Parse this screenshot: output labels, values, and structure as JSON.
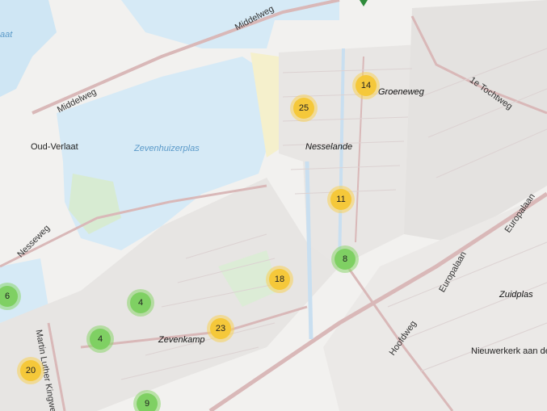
{
  "map": {
    "place_labels": {
      "groeneweg": "Groeneweg",
      "nesselande": "Nesselande",
      "zevenhuizerplas": "Zevenhuizerplas",
      "oud_verlaat": "Oud-Verlaat",
      "zevenkamp": "Zevenkamp",
      "zuidplas": "Zuidplas",
      "nieuwerkerk": "Nieuwerkerk aan de",
      "aat": "aat"
    },
    "road_labels": {
      "middelweg_top": "Middelweg",
      "middelweg_left": "Middelweg",
      "tochtweg": "1e Tochtweg",
      "europalaan_1": "Europalaan",
      "europalaan_2": "Europalaan",
      "nesseweg": "Nesseweg",
      "hoofdweg": "Hoofdweg",
      "martin_luther": "Martin Luther Kingweg"
    },
    "clusters": [
      {
        "id": "c14",
        "count": "14",
        "color": "yellow"
      },
      {
        "id": "c25",
        "count": "25",
        "color": "yellow"
      },
      {
        "id": "c11",
        "count": "11",
        "color": "yellow"
      },
      {
        "id": "c8",
        "count": "8",
        "color": "green"
      },
      {
        "id": "c18",
        "count": "18",
        "color": "yellow"
      },
      {
        "id": "c6",
        "count": "6",
        "color": "green"
      },
      {
        "id": "c4a",
        "count": "4",
        "color": "green"
      },
      {
        "id": "c4b",
        "count": "4",
        "color": "green"
      },
      {
        "id": "c23",
        "count": "23",
        "color": "yellow"
      },
      {
        "id": "c20",
        "count": "20",
        "color": "yellow"
      },
      {
        "id": "c9",
        "count": "9",
        "color": "green"
      }
    ],
    "colors": {
      "water": "#cfe6f4",
      "land": "#f2f1ef",
      "road": "#d9b8b8",
      "cluster_yellow": "#f5c83a",
      "cluster_green": "#7fd063"
    }
  }
}
